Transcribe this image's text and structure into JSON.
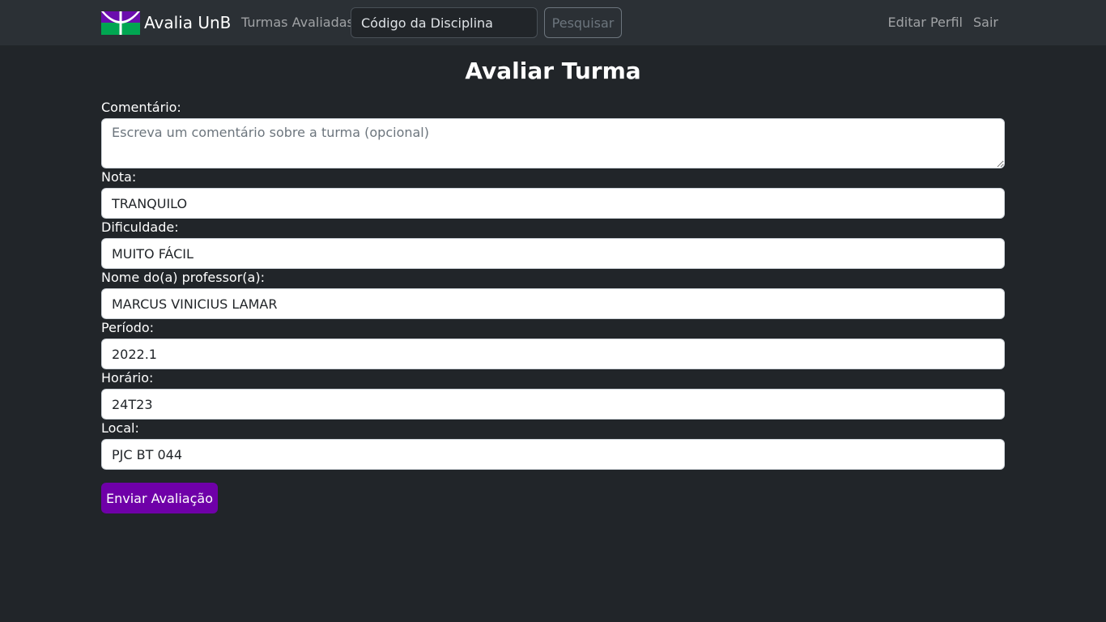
{
  "navbar": {
    "brand_text": "Avalia UnB",
    "brand_icon": "unb-logo-icon",
    "turmas_label": "Turmas Avaliadas",
    "search": {
      "placeholder": "Código da Disciplina",
      "value": ""
    },
    "search_button_label": "Pesquisar",
    "editar_perfil_label": "Editar Perfil",
    "sair_label": "Sair"
  },
  "main": {
    "title": "Avaliar Turma",
    "comentario": {
      "label": "Comentário:",
      "placeholder": "Escreva um comentário sobre a turma (opcional)",
      "value": ""
    },
    "nota": {
      "label": "Nota:",
      "value": "TRANQUILO"
    },
    "dificuldade": {
      "label": "Dificuldade:",
      "value": "MUITO FÁCIL"
    },
    "professor": {
      "label": "Nome do(a) professor(a):",
      "value": "MARCUS VINICIUS LAMAR"
    },
    "periodo": {
      "label": "Período:",
      "value": "2022.1"
    },
    "horario": {
      "label": "Horário:",
      "value": "24T23"
    },
    "local": {
      "label": "Local:",
      "value": "PJC BT 044"
    },
    "submit_label": "Enviar Avaliação"
  },
  "colors": {
    "page_background": "#212529",
    "navbar_background": "#2b3035",
    "submit_button": "#6f00a8",
    "logo_purple": "#6a0dad",
    "logo_green": "#00a651"
  }
}
